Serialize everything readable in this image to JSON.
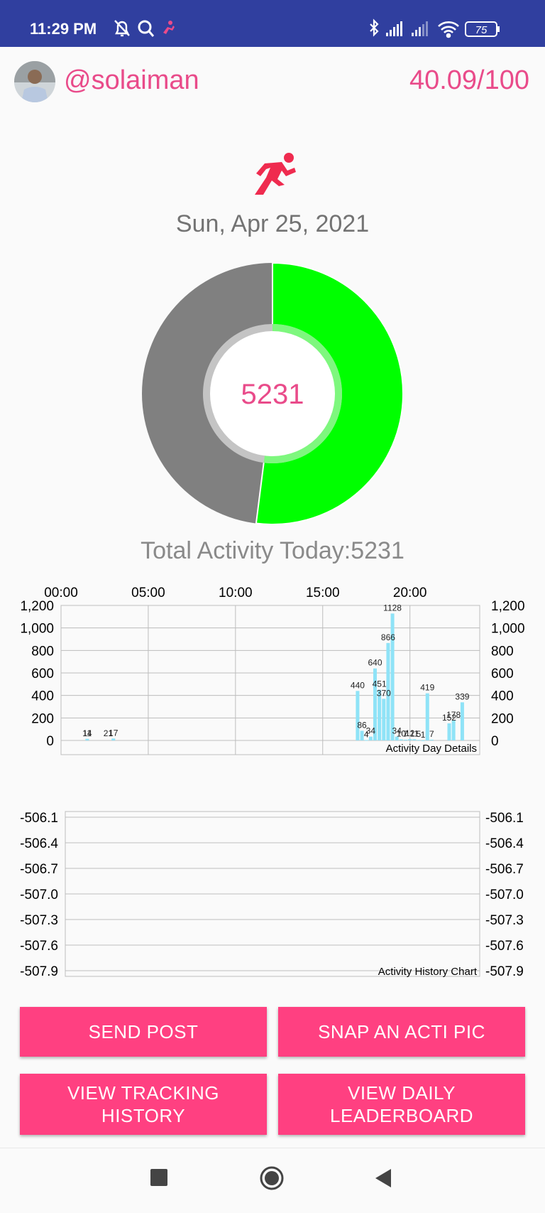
{
  "status_bar": {
    "time": "11:29 PM",
    "battery": "75"
  },
  "profile": {
    "username": "@solaiman",
    "score": "40.09/100"
  },
  "date": "Sun, Apr 25, 2021",
  "donut": {
    "center_value": "5231",
    "progress_fraction": 0.52,
    "colors": {
      "progress": "#00ff00",
      "remainder": "#808080"
    }
  },
  "total_activity": "Total Activity Today:5231",
  "chart_data": [
    {
      "type": "bar",
      "title": "",
      "description": "Activity Day Details",
      "x_tick_labels": [
        "00:00",
        "05:00",
        "10:00",
        "15:00",
        "20:00"
      ],
      "x_tick_hours": [
        0,
        5,
        10,
        15,
        20
      ],
      "xlim": [
        0,
        24
      ],
      "ylim": [
        0,
        1200
      ],
      "y_tick_labels": [
        "1,200",
        "1,000",
        "800",
        "600",
        "400",
        "200",
        "0"
      ],
      "y_tick_values": [
        1200,
        1000,
        800,
        600,
        400,
        200,
        0
      ],
      "grid": true,
      "color": "#8fe3f7",
      "x": [
        1.5,
        3.0,
        17.0,
        17.25,
        17.5,
        17.75,
        18.0,
        18.25,
        18.5,
        18.75,
        19.0,
        19.25,
        19.5,
        19.75,
        20.0,
        20.25,
        20.5,
        20.75,
        21.0,
        21.25,
        22.25,
        22.5,
        23.0
      ],
      "values": [
        14,
        17,
        440,
        86,
        4,
        34,
        640,
        451,
        370,
        866,
        1128,
        34,
        10,
        7,
        12,
        11,
        5,
        1,
        419,
        7,
        152,
        178,
        339
      ],
      "data_labels": [
        {
          "x": 1.5,
          "y": 14,
          "text": "14"
        },
        {
          "x": 1.5,
          "y": 14,
          "text": "11"
        },
        {
          "x": 2.7,
          "y": 14,
          "text": "21"
        },
        {
          "x": 3.0,
          "y": 17,
          "text": "17"
        },
        {
          "x": 17.0,
          "y": 440,
          "text": "440"
        },
        {
          "x": 17.25,
          "y": 86,
          "text": "86"
        },
        {
          "x": 17.5,
          "y": 4,
          "text": "4"
        },
        {
          "x": 17.75,
          "y": 34,
          "text": "34"
        },
        {
          "x": 18.0,
          "y": 640,
          "text": "640"
        },
        {
          "x": 18.25,
          "y": 451,
          "text": "451"
        },
        {
          "x": 18.5,
          "y": 370,
          "text": "370"
        },
        {
          "x": 18.75,
          "y": 866,
          "text": "866"
        },
        {
          "x": 19.0,
          "y": 1128,
          "text": "1128"
        },
        {
          "x": 19.25,
          "y": 34,
          "text": "34"
        },
        {
          "x": 19.5,
          "y": 10,
          "text": "10"
        },
        {
          "x": 19.75,
          "y": 7,
          "text": "7"
        },
        {
          "x": 20.0,
          "y": 12,
          "text": "12"
        },
        {
          "x": 20.25,
          "y": 11,
          "text": "11"
        },
        {
          "x": 20.5,
          "y": 5,
          "text": "5"
        },
        {
          "x": 20.75,
          "y": 1,
          "text": "1"
        },
        {
          "x": 21.0,
          "y": 419,
          "text": "419"
        },
        {
          "x": 21.25,
          "y": 7,
          "text": "7"
        },
        {
          "x": 22.25,
          "y": 152,
          "text": "152"
        },
        {
          "x": 22.5,
          "y": 178,
          "text": "178"
        },
        {
          "x": 23.0,
          "y": 339,
          "text": "339"
        }
      ]
    },
    {
      "type": "line",
      "title": "",
      "description": "Activity History Chart",
      "ylim": [
        -507.9,
        -506.1
      ],
      "y_tick_labels": [
        "-506.1",
        "-506.4",
        "-506.7",
        "-507.0",
        "-507.3",
        "-507.6",
        "-507.9"
      ],
      "y_tick_values": [
        -506.1,
        -506.4,
        -506.7,
        -507.0,
        -507.3,
        -507.6,
        -507.9
      ],
      "grid": true,
      "series": []
    }
  ],
  "buttons": {
    "send_post": "SEND POST",
    "snap_pic": "SNAP AN ACTI PIC",
    "tracking_history_line1": "VIEW TRACKING",
    "tracking_history_line2": "HISTORY",
    "daily_leaderboard_line1": "VIEW DAILY",
    "daily_leaderboard_line2": "LEADERBOARD"
  },
  "accent_color": "#ff4081"
}
